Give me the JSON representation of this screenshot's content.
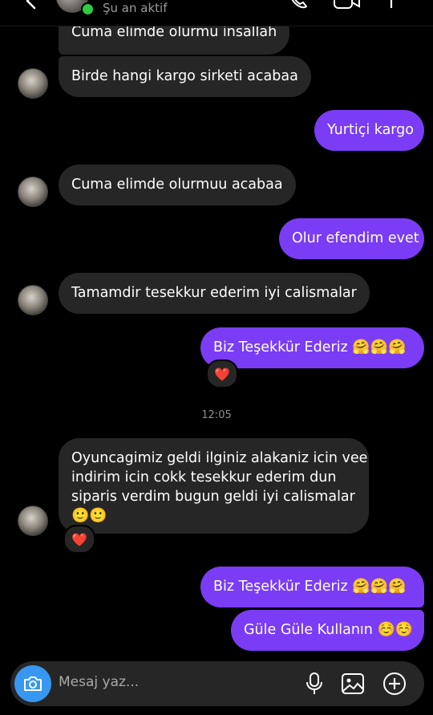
{
  "header": {
    "status": "Şu an aktif",
    "icons": [
      "back-icon",
      "phone-icon",
      "video-icon",
      "info-icon"
    ]
  },
  "messages": [
    {
      "id": "m1",
      "side": "in",
      "text": "Cuma elimde olurmu insallah"
    },
    {
      "id": "m2",
      "side": "in",
      "text": "Birde hangi kargo sirketi acabaa"
    },
    {
      "id": "m3",
      "side": "out",
      "text": "Yurtiçi kargo"
    },
    {
      "id": "m4",
      "side": "in",
      "text": "Cuma elimde olurmuu acabaa"
    },
    {
      "id": "m5",
      "side": "out",
      "text": "Olur efendim evet"
    },
    {
      "id": "m6",
      "side": "in",
      "text": "Tamamdir tesekkur ederim iyi calismalar"
    },
    {
      "id": "m7",
      "side": "out",
      "text": "Biz Teşekkür Ederiz",
      "emojis": "🤗🤗🤗",
      "reaction": "❤️"
    },
    {
      "id": "m8",
      "side": "in",
      "lines": [
        "Oyuncagimiz geldi ilginiz alakaniz icin vee",
        "indirim icin cokk tesekkur ederim dun",
        "siparis verdim bugun geldi iyi calismalar"
      ],
      "emojis": "🙂🙂",
      "reaction": "❤️"
    },
    {
      "id": "m9",
      "side": "out",
      "text": "Biz Teşekkür Ederiz",
      "emojis": "🤗🤗🤗"
    },
    {
      "id": "m10",
      "side": "out",
      "text": "Güle Güle Kullanın",
      "emojis": "☺️☺️"
    }
  ],
  "timestamp": "12:05",
  "composer": {
    "placeholder": "Mesaj yaz...",
    "icons": [
      "camera-icon",
      "microphone-icon",
      "gallery-icon",
      "add-icon"
    ]
  },
  "colors": {
    "background": "#000000",
    "incoming_bubble": "#262626",
    "outgoing_bubble": "#7a3cf5",
    "camera_button": "#3897f0",
    "online": "#2ecc40"
  }
}
